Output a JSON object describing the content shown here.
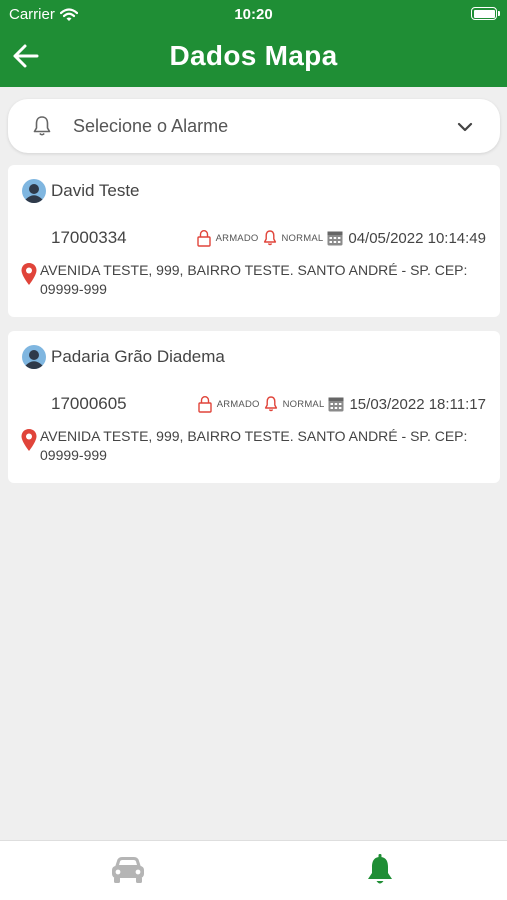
{
  "status_bar": {
    "carrier": "Carrier",
    "time": "10:20"
  },
  "header": {
    "title": "Dados Mapa"
  },
  "alarm_select": {
    "placeholder": "Selecione o Alarme"
  },
  "cards": [
    {
      "name": "David Teste",
      "code": "17000334",
      "armed_label": "ARMADO",
      "state_label": "NORMAL",
      "datetime": "04/05/2022 10:14:49",
      "address": "AVENIDA  TESTE, 999, BAIRRO TESTE. SANTO ANDRÉ - SP. CEP: 09999-999"
    },
    {
      "name": "Padaria Grão Diadema",
      "code": "17000605",
      "armed_label": "ARMADO",
      "state_label": "NORMAL",
      "datetime": "15/03/2022 18:11:17",
      "address": "AVENIDA  TESTE, 999, BAIRRO TESTE. SANTO ANDRÉ - SP. CEP: 09999-999"
    }
  ],
  "tab_bar": {
    "tabs": [
      {
        "icon": "car-icon",
        "active": false
      },
      {
        "icon": "bell-icon",
        "active": true
      }
    ]
  },
  "colors": {
    "primary": "#1f8e35",
    "alert_red": "#e0443a",
    "background": "#efefef",
    "inactive_icon": "#b5b5b5"
  }
}
